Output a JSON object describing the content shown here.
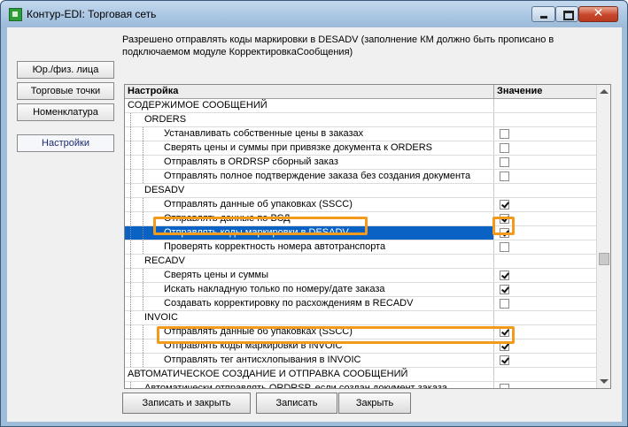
{
  "window": {
    "title": "Контур-EDI: Торговая сеть"
  },
  "info_text": "Разрешено отправлять коды маркировки в DESADV (заполнение КМ должно быть прописано в подключаемом модуле КорректировкаСообщения)",
  "nav": [
    {
      "label": "Юр./физ. лица"
    },
    {
      "label": "Торговые точки"
    },
    {
      "label": "Номенклатура"
    },
    {
      "label": "Настройки"
    }
  ],
  "grid": {
    "header": {
      "col1": "Настройка",
      "col2": "Значение"
    },
    "rows": [
      {
        "label": "СОДЕРЖИМОЕ СООБЩЕНИЙ",
        "level": 0,
        "checkbox": false
      },
      {
        "label": "ORDERS",
        "level": 1,
        "checkbox": false
      },
      {
        "label": "Устанавливать собственные цены в заказах",
        "level": 2,
        "checkbox": true,
        "checked": false
      },
      {
        "label": "Сверять цены и суммы при привязке документа к ORDERS",
        "level": 2,
        "checkbox": true,
        "checked": false
      },
      {
        "label": "Отправлять в ORDRSP сборный заказ",
        "level": 2,
        "checkbox": true,
        "checked": false
      },
      {
        "label": "Отправлять полное подтверждение заказа без создания документа",
        "level": 2,
        "checkbox": true,
        "checked": false
      },
      {
        "label": "DESADV",
        "level": 1,
        "checkbox": false
      },
      {
        "label": "Отправлять данные об упаковках (SSCC)",
        "level": 2,
        "checkbox": true,
        "checked": true
      },
      {
        "label": "Отправлять данные по ВСД",
        "level": 2,
        "checkbox": true,
        "checked": true
      },
      {
        "label": "Отправлять коды маркировки в DESADV",
        "level": 2,
        "checkbox": true,
        "checked": true,
        "selected": true
      },
      {
        "label": "Проверять корректность номера автотранспорта",
        "level": 2,
        "checkbox": true,
        "checked": false
      },
      {
        "label": "RECADV",
        "level": 1,
        "checkbox": false
      },
      {
        "label": "Сверять цены и суммы",
        "level": 2,
        "checkbox": true,
        "checked": true
      },
      {
        "label": "Искать накладную только по номеру/дате заказа",
        "level": 2,
        "checkbox": true,
        "checked": true
      },
      {
        "label": "Создавать корректировку по расхождениям в RECADV",
        "level": 2,
        "checkbox": true,
        "checked": false
      },
      {
        "label": "INVOIC",
        "level": 1,
        "checkbox": false
      },
      {
        "label": "Отправлять данные об упаковках (SSCC)",
        "level": 2,
        "checkbox": true,
        "checked": true
      },
      {
        "label": "Отправлять коды маркировки в INVOIC",
        "level": 2,
        "checkbox": true,
        "checked": true
      },
      {
        "label": "Отправлять тег антисхлопывания в INVOIC",
        "level": 2,
        "checkbox": true,
        "checked": true
      },
      {
        "label": "АВТОМАТИЧЕСКОЕ СОЗДАНИЕ И ОТПРАВКА СООБЩЕНИЙ",
        "level": 0,
        "checkbox": false
      },
      {
        "label": "Автоматически отправлять ORDRSP, если создан документ заказа",
        "level": 1,
        "checkbox": true,
        "checked": false
      }
    ]
  },
  "buttons": {
    "save_close": "Записать и закрыть",
    "save": "Записать",
    "close": "Закрыть"
  },
  "colors": {
    "selection": "#0a62c4",
    "highlight": "#f39a1c"
  }
}
